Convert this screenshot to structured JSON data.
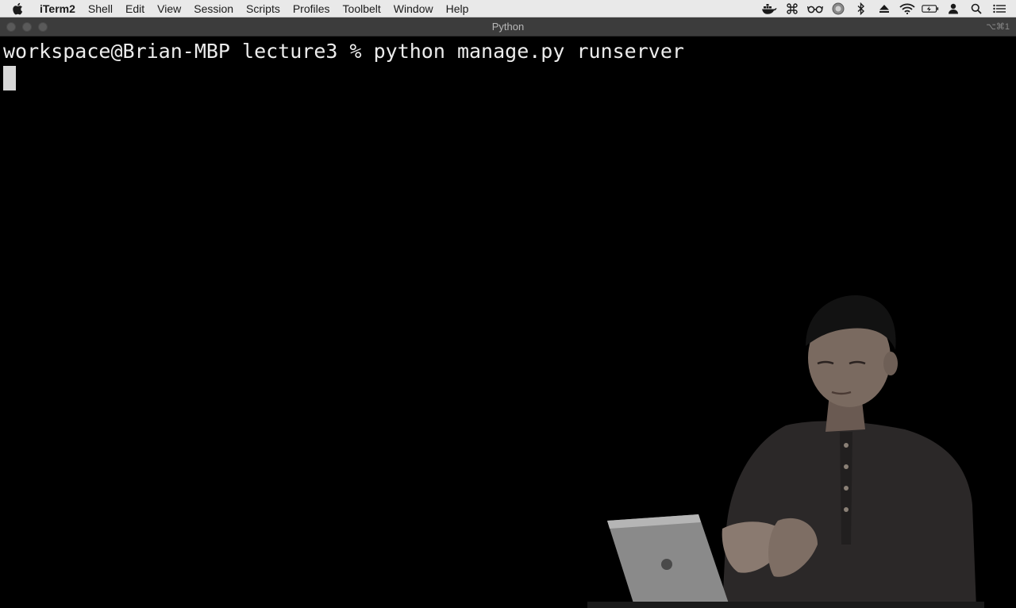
{
  "menubar": {
    "app_name": "iTerm2",
    "items": [
      "Shell",
      "Edit",
      "View",
      "Session",
      "Scripts",
      "Profiles",
      "Toolbelt",
      "Window",
      "Help"
    ],
    "status_icons": [
      "docker-icon",
      "command-icon",
      "glasses-icon",
      "circle-badge-icon",
      "bluetooth-icon",
      "eject-icon",
      "wifi-icon",
      "battery-charging-icon",
      "user-icon",
      "search-icon",
      "list-icon"
    ]
  },
  "window": {
    "title": "Python",
    "shortcut": "⌥⌘1"
  },
  "terminal": {
    "prompt_line": "workspace@Brian-MBP lecture3 % python manage.py runserver"
  },
  "colors": {
    "menubar_bg": "#e9e9e9",
    "titlebar_bg": "#3c3c3c",
    "terminal_bg": "#000000",
    "terminal_fg": "#ececec"
  }
}
